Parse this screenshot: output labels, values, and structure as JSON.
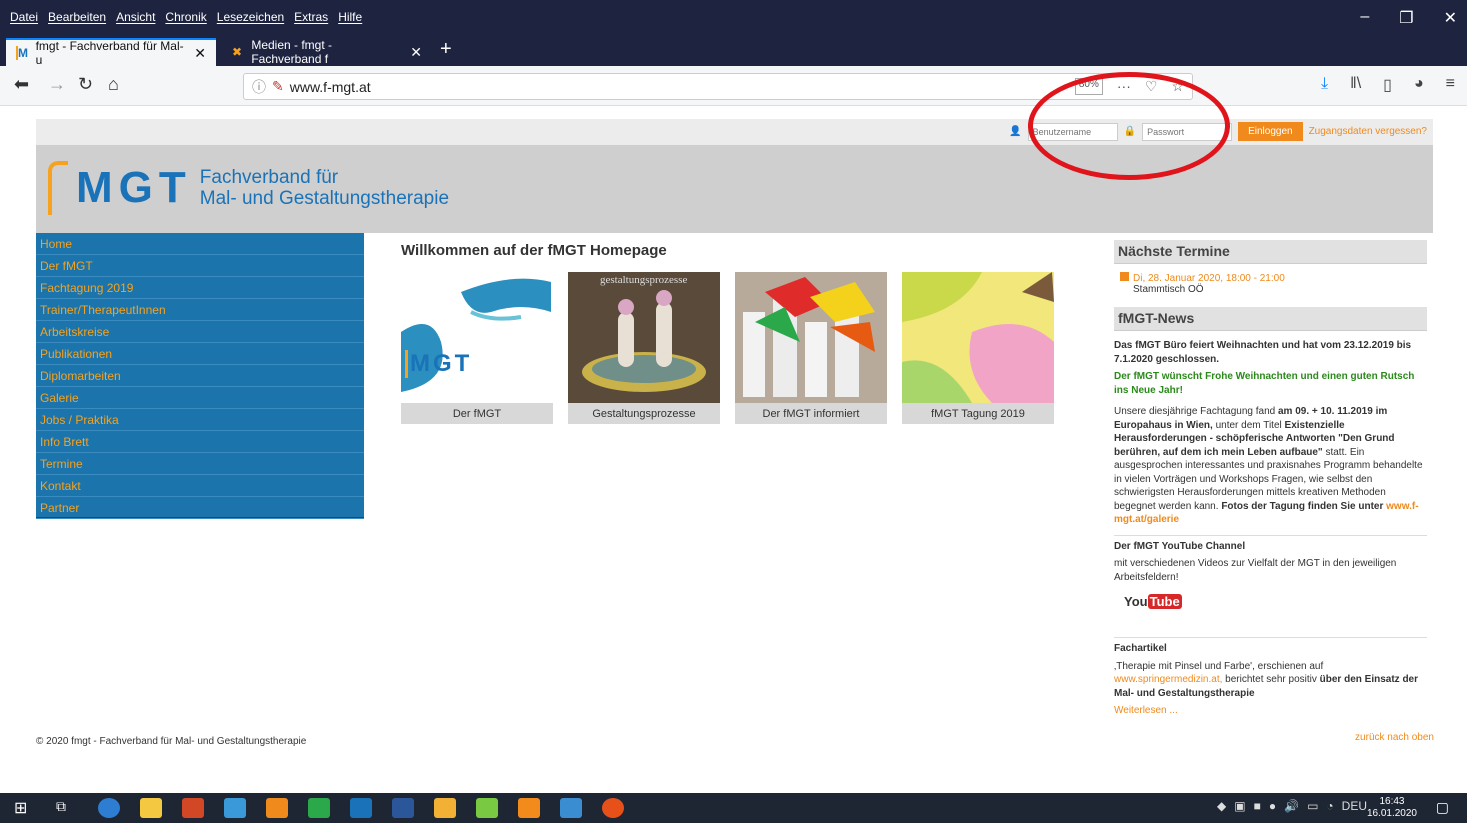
{
  "browser": {
    "menu": [
      "Datei",
      "Bearbeiten",
      "Ansicht",
      "Chronik",
      "Lesezeichen",
      "Extras",
      "Hilfe"
    ],
    "tabs": [
      {
        "label": "fmgt - Fachverband für Mal- u"
      },
      {
        "label": "Medien - fmgt - Fachverband f"
      }
    ],
    "url": "www.f-mgt.at",
    "zoom": "80%"
  },
  "login": {
    "username_placeholder": "Benutzername",
    "password_placeholder": "Passwort",
    "login_button": "Einloggen",
    "forgot": "Zugangsdaten vergessen?"
  },
  "header": {
    "logo": "MGT",
    "tagline_1": "Fachverband für",
    "tagline_2": "Mal- und Gestaltungstherapie"
  },
  "nav": [
    "Home",
    "Der fMGT",
    "Fachtagung 2019",
    "Trainer/TherapeutInnen",
    "Arbeitskreise",
    "Publikationen",
    "Diplomarbeiten",
    "Galerie",
    "Jobs / Praktika",
    "Info Brett",
    "Termine",
    "Kontakt",
    "Partner"
  ],
  "main": {
    "title": "Willkommen auf der fMGT Homepage",
    "tiles": [
      {
        "caption": "Der fMGT",
        "img_text": "MGT"
      },
      {
        "caption": "Gestaltungsprozesse",
        "img_text": "gestaltungsprozesse"
      },
      {
        "caption": "Der fMGT informiert"
      },
      {
        "caption": "fMGT Tagung 2019"
      }
    ]
  },
  "right": {
    "termine_head": "Nächste Termine",
    "event_date": "Di, 28. Januar 2020, 18:00 - 21:00",
    "event_title": "Stammtisch OÖ",
    "news_head": "fMGT-News",
    "news1": "Das fMGT Büro feiert Weihnachten und hat vom 23.12.2019 bis 7.1.2020 geschlossen.",
    "news2": "Der fMGT wünscht Frohe Weihnachten und einen guten Rutsch ins Neue Jahr!",
    "news3a": "Unsere diesjährige Fachtagung fand",
    "news3b": "am 09. + 10. 11.2019 im Europahaus in Wien,",
    "news3c": "unter dem Titel",
    "news3d": "Existenzielle Herausforderungen - schöpferische Antworten \"Den Grund berühren, auf dem ich mein Leben aufbaue\"",
    "news3e": "statt. Ein ausgesprochen interessantes und praxisnahes Programm behandelte in vielen Vorträgen und Workshops Fragen, wie selbst den schwierigsten Herausforderungen mittels kreativen Methoden begegnet werden kann.",
    "news3f": "Fotos der Tagung finden Sie unter",
    "news3g": "www.f-mgt.at/galerie",
    "yt_head": "Der fMGT YouTube Channel",
    "yt_text": "mit verschiedenen Videos zur Vielfalt der MGT in den jeweiligen Arbeitsfeldern!",
    "yt_you": "You",
    "yt_tube": "Tube",
    "art_head": "Fachartikel",
    "art_a": "‚Therapie mit Pinsel und Farbe', erschienen auf",
    "art_link": "www.springermedizin.at,",
    "art_b": "berichtet sehr positiv",
    "art_c": "über den Einsatz der Mal- und Gestaltungstherapie",
    "art_more": "Weiterlesen ..."
  },
  "footer": {
    "copyright": "© 2020 fmgt - Fachverband für Mal- und Gestaltungstherapie",
    "back_top": "zurück nach oben"
  },
  "taskbar": {
    "lang": "DEU",
    "time": "16:43",
    "date": "16.01.2020"
  },
  "colors": {
    "accent_orange": "#f08a1c",
    "nav_blue": "#1b74ab",
    "highlight_red": "#e0141b"
  }
}
